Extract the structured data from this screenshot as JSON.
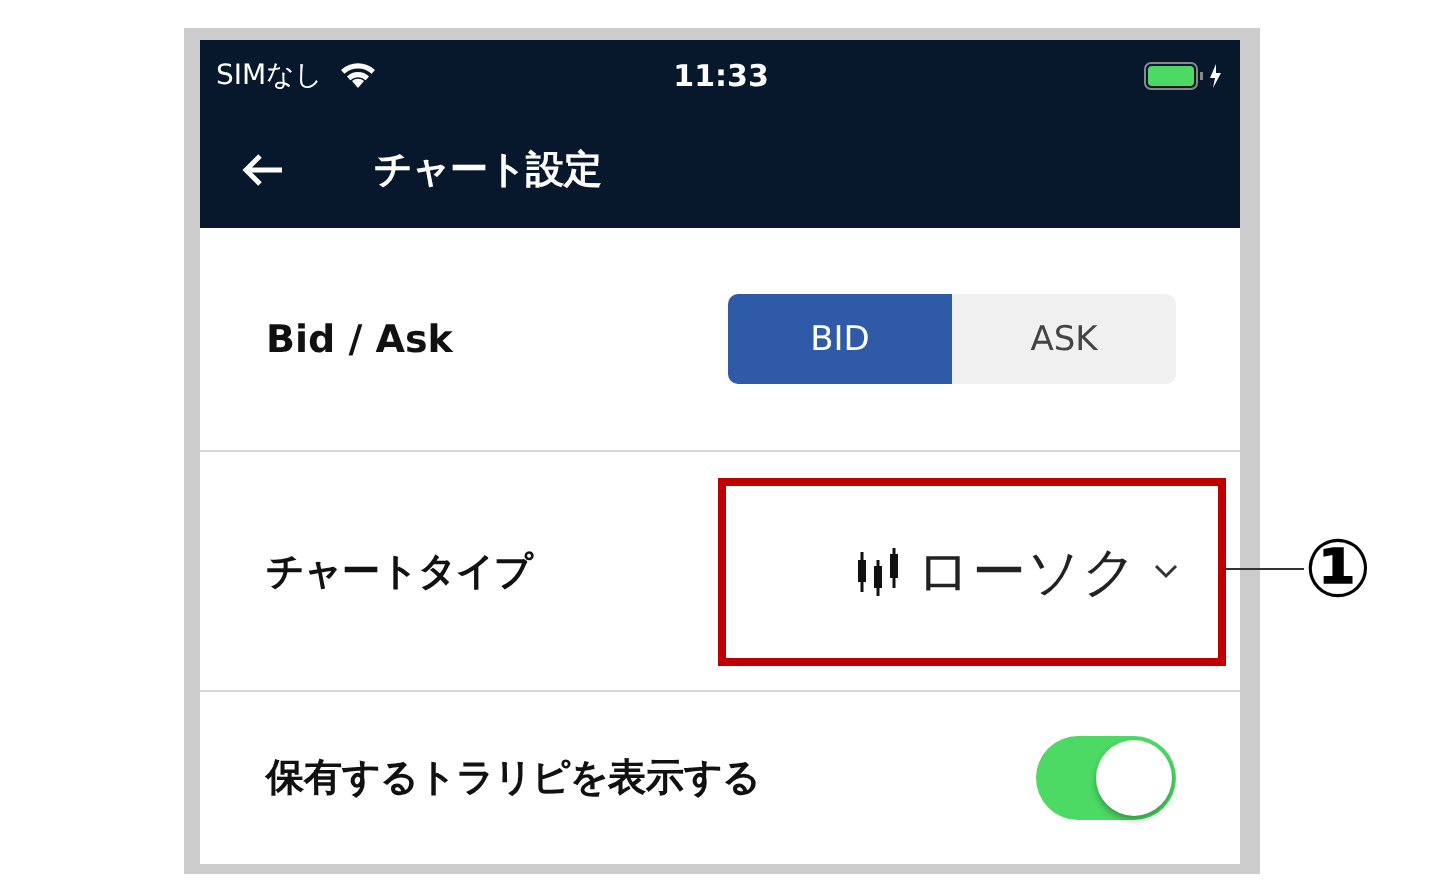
{
  "status_bar": {
    "carrier": "SIMなし",
    "time": "11:33"
  },
  "nav": {
    "title": "チャート設定"
  },
  "rows": [
    {
      "kind": "segmented",
      "label": "Bid / Ask",
      "options": [
        {
          "label": "BID",
          "selected": true
        },
        {
          "label": "ASK",
          "selected": false
        }
      ]
    },
    {
      "kind": "dropdown",
      "label": "チャートタイプ",
      "value": "ローソク",
      "highlighted": true
    },
    {
      "kind": "toggle",
      "label": "保有するトラリピを表示する",
      "on": true
    }
  ],
  "annotation": {
    "marker": "①"
  }
}
